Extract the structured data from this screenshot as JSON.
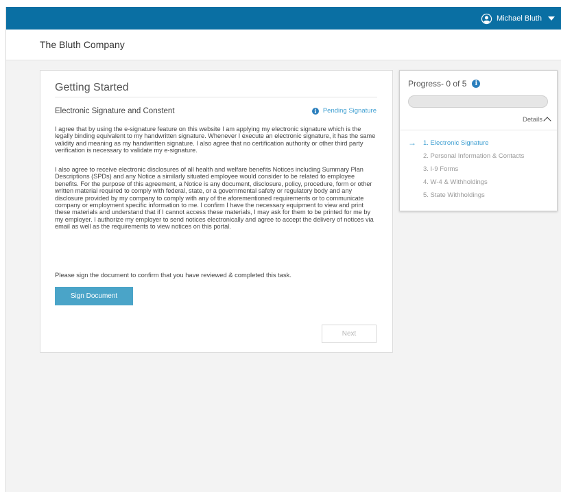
{
  "header": {
    "user_name": "Michael Bluth",
    "user_icon": "user-circle-icon",
    "menu_icon": "caret-down-icon"
  },
  "company": {
    "name": "The Bluth Company"
  },
  "main": {
    "title": "Getting Started",
    "section_title": "Electronic Signature and Constent",
    "status": "Pending Signature",
    "paragraph1": "I agree that by using the e-signature feature on this website I am applying my electronic signature which is the legally binding equivalent to my handwritten signature. Whenever I execute an electronic signature, it has the same validity and meaning as my handwritten signature. I also agree that no certification authority or other third party verification is necessary to validate my e-signature.",
    "paragraph2": "I also agree to receive electronic disclosures of all health and welfare benefits Notices including Summary Plan Descriptions (SPDs) and any Notice a similarly situated employee would consider to be related to employee benefits. For the purpose of this agreement, a Notice is any document, disclosure, policy, procedure, form or other written material required to comply with federal, state, or a governmental safety or regulatory body and any disclosure provided by my company to comply with any of the aforementioned requirements or to communicate company or employment specific information to me. I confirm I have the necessary equipment to view and print these materials and understand that if I cannot access these materials, I may ask for them to be printed for me by my employer. I authorize my employer to send notices electronically and agree to accept the delivery of notices via email as well as the requirements to view notices on this portal.",
    "prompt": "Please sign the document to confirm that you have reviewed & completed this task.",
    "sign_label": "Sign Document",
    "next_label": "Next"
  },
  "progress": {
    "title": "Progress- 0 of 5",
    "completed": 0,
    "total": 5,
    "details_label": "Details",
    "steps": [
      {
        "label": "1. Electronic Signature",
        "active": true
      },
      {
        "label": "2. Personal Information & Contacts",
        "active": false
      },
      {
        "label": "3. I-9 Forms",
        "active": false
      },
      {
        "label": "4. W-4 & Withholdings",
        "active": false
      },
      {
        "label": "5. State Withholdings",
        "active": false
      }
    ]
  },
  "colors": {
    "topbar": "#0a6fa3",
    "accent": "#3f9fd1",
    "button": "#4aa4c8",
    "info_icon": "#2b7fbd"
  }
}
